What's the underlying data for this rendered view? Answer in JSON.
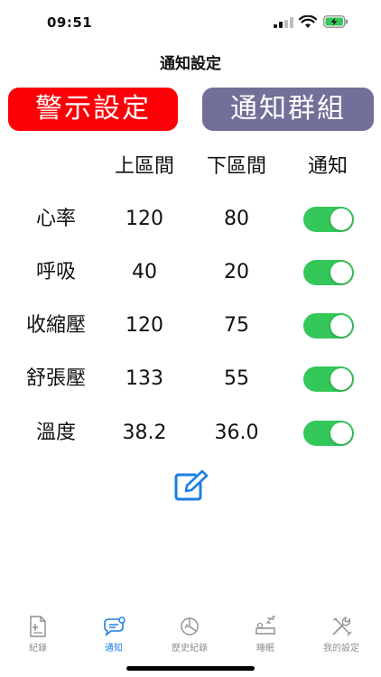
{
  "status_bar": {
    "time": "09:51"
  },
  "nav": {
    "title": "通知設定"
  },
  "buttons": {
    "alert_settings": "警示設定",
    "notify_group": "通知群組"
  },
  "table": {
    "headers": {
      "upper": "上區間",
      "lower": "下區間",
      "notify": "通知"
    },
    "rows": [
      {
        "label": "心率",
        "upper": "120",
        "lower": "80",
        "notify": true
      },
      {
        "label": "呼吸",
        "upper": "40",
        "lower": "20",
        "notify": true
      },
      {
        "label": "收縮壓",
        "upper": "120",
        "lower": "75",
        "notify": true
      },
      {
        "label": "舒張壓",
        "upper": "133",
        "lower": "55",
        "notify": true
      },
      {
        "label": "溫度",
        "upper": "38.2",
        "lower": "36.0",
        "notify": true
      }
    ]
  },
  "tabs": [
    {
      "label": "紀錄",
      "icon": "record-icon",
      "active": false
    },
    {
      "label": "通知",
      "icon": "chat-notify-icon",
      "active": true
    },
    {
      "label": "歷史紀錄",
      "icon": "history-chart-icon",
      "active": false
    },
    {
      "label": "睡眠",
      "icon": "sleep-icon",
      "active": false
    },
    {
      "label": "我的設定",
      "icon": "tools-icon",
      "active": false
    }
  ],
  "colors": {
    "alert_button": "#fb0007",
    "group_button": "#726f98",
    "toggle_on": "#34c759",
    "accent": "#1e7ee5",
    "tab_inactive": "#8e8e93"
  }
}
